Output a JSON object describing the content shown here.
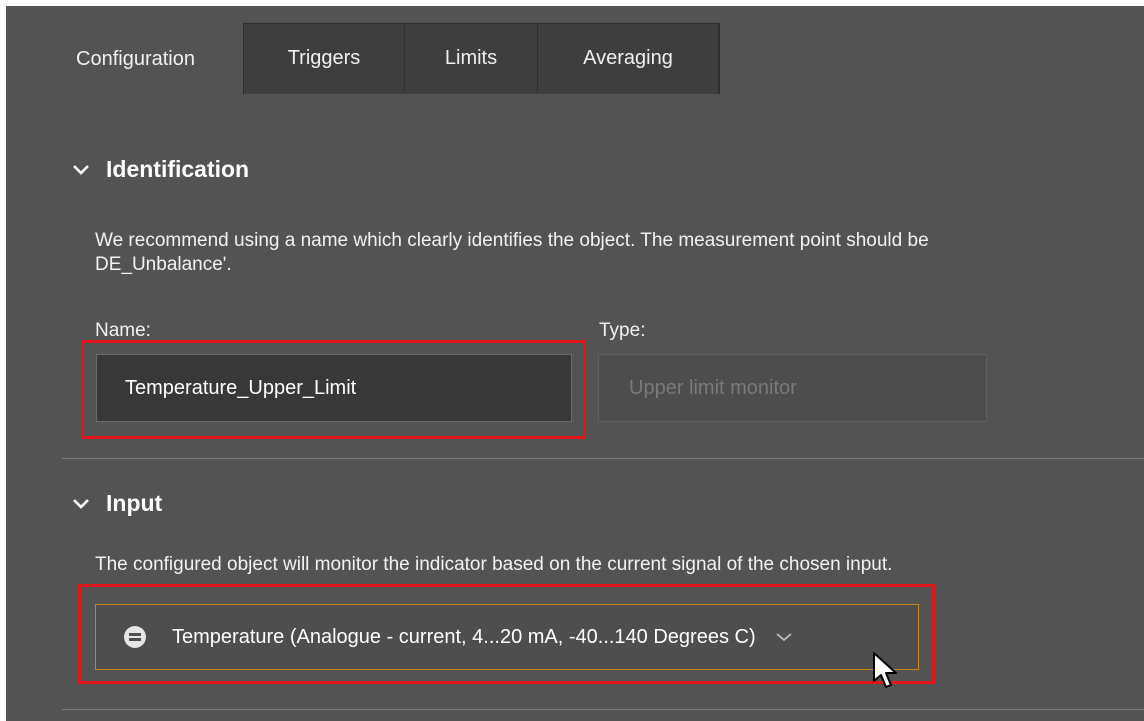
{
  "tabs": [
    {
      "label": "Configuration",
      "active": true
    },
    {
      "label": "Triggers",
      "active": false
    },
    {
      "label": "Limits",
      "active": false
    },
    {
      "label": "Averaging",
      "active": false
    }
  ],
  "identification": {
    "heading": "Identification",
    "description_line1": "We recommend using a name which clearly identifies the object. The measurement point should be",
    "description_line2": "DE_Unbalance'.",
    "name_label": "Name:",
    "name_value": "Temperature_Upper_Limit",
    "type_label": "Type:",
    "type_value": "Upper limit monitor"
  },
  "input": {
    "heading": "Input",
    "description": "The configured object will monitor the indicator based on the current signal of the chosen input.",
    "selected_value": "Temperature (Analogue - current, 4...20 mA, -40...140 Degrees C)"
  },
  "colors": {
    "panel": "#535353",
    "tab_strip": "#3e3e3e",
    "highlight": "#e0141b",
    "focus_border": "#c8851a"
  }
}
